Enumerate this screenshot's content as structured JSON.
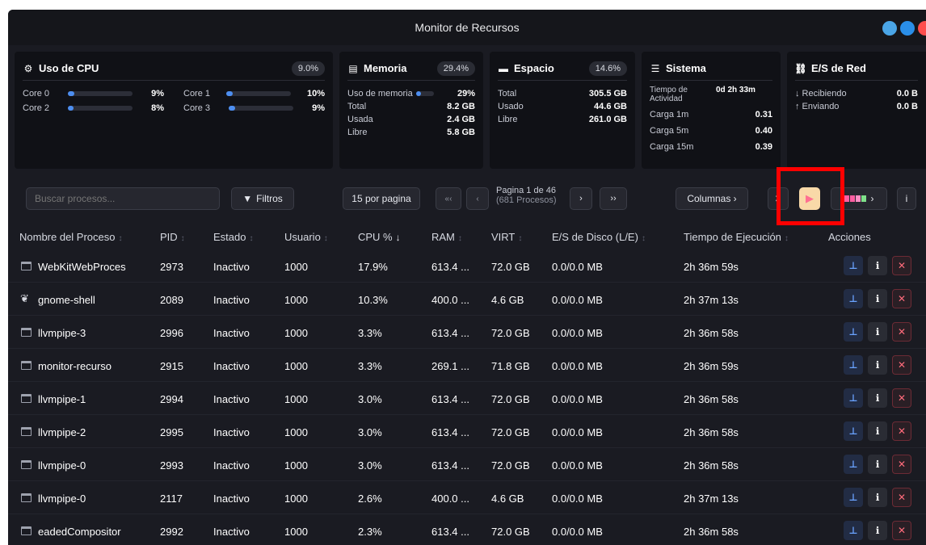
{
  "window": {
    "title": "Monitor de Recursos",
    "controls": [
      "#4aa5e6",
      "#2a8ee8",
      "#ff4d4d"
    ]
  },
  "cpu": {
    "title": "Uso de CPU",
    "badge": "9.0%",
    "cores": [
      {
        "name": "Core 0",
        "value": "9%",
        "pct": 0.09
      },
      {
        "name": "Core 1",
        "value": "10%",
        "pct": 0.1
      },
      {
        "name": "Core 2",
        "value": "8%",
        "pct": 0.08
      },
      {
        "name": "Core 3",
        "value": "9%",
        "pct": 0.09
      }
    ]
  },
  "memory": {
    "title": "Memoria",
    "badge": "29.4%",
    "usage_label": "Uso de memoria",
    "usage_value": "29%",
    "usage_pct": 0.29,
    "rows": [
      {
        "label": "Total",
        "value": "8.2 GB"
      },
      {
        "label": "Usada",
        "value": "2.4 GB"
      },
      {
        "label": "Libre",
        "value": "5.8 GB"
      }
    ]
  },
  "disk": {
    "title": "Espacio",
    "badge": "14.6%",
    "rows": [
      {
        "label": "Total",
        "value": "305.5 GB"
      },
      {
        "label": "Usado",
        "value": "44.6 GB"
      },
      {
        "label": "Libre",
        "value": "261.0 GB"
      }
    ]
  },
  "system": {
    "title": "Sistema",
    "uptime_label": "Tiempo de Actividad",
    "uptime_value": "0d 2h 33m",
    "rows": [
      {
        "label": "Carga 1m",
        "value": "0.31"
      },
      {
        "label": "Carga 5m",
        "value": "0.40"
      },
      {
        "label": "Carga 15m",
        "value": "0.39"
      }
    ]
  },
  "network": {
    "title": "E/S de Red",
    "rows": [
      {
        "label": "↓ Recibiendo",
        "value": "0.0 B"
      },
      {
        "label": "↑ Enviando",
        "value": "0.0 B"
      }
    ]
  },
  "toolbar": {
    "search_placeholder": "Buscar procesos...",
    "filters": "Filtros",
    "per_page": "15 por pagina",
    "first": "«‹",
    "prev": "‹",
    "page": "Pagina 1 de 46",
    "processes": "(681 Procesos)",
    "next": "›",
    "last": "››",
    "columns": "Columnas ›",
    "refresh": "3",
    "colors_more": "›",
    "info": "i"
  },
  "table": {
    "headers": [
      "Nombre del Proceso",
      "PID",
      "Estado",
      "Usuario",
      "CPU %",
      "RAM",
      "VIRT",
      "E/S de Disco (L/E)",
      "Tiempo de Ejecución",
      "Acciones"
    ],
    "rows": [
      {
        "name": "WebKitWebProces",
        "pid": "2973",
        "state": "Inactivo",
        "user": "1000",
        "cpu": "17.9%",
        "ram": "613.4 ...",
        "virt": "72.0 GB",
        "io": "0.0/0.0 MB",
        "time": "2h 36m 59s"
      },
      {
        "name": "gnome-shell",
        "pid": "2089",
        "state": "Inactivo",
        "user": "1000",
        "cpu": "10.3%",
        "ram": "400.0 ...",
        "virt": "4.6 GB",
        "io": "0.0/0.0 MB",
        "time": "2h 37m 13s"
      },
      {
        "name": "llvmpipe-3",
        "pid": "2996",
        "state": "Inactivo",
        "user": "1000",
        "cpu": "3.3%",
        "ram": "613.4 ...",
        "virt": "72.0 GB",
        "io": "0.0/0.0 MB",
        "time": "2h 36m 58s"
      },
      {
        "name": "monitor-recurso",
        "pid": "2915",
        "state": "Inactivo",
        "user": "1000",
        "cpu": "3.3%",
        "ram": "269.1 ...",
        "virt": "71.8 GB",
        "io": "0.0/0.0 MB",
        "time": "2h 36m 59s"
      },
      {
        "name": "llvmpipe-1",
        "pid": "2994",
        "state": "Inactivo",
        "user": "1000",
        "cpu": "3.0%",
        "ram": "613.4 ...",
        "virt": "72.0 GB",
        "io": "0.0/0.0 MB",
        "time": "2h 36m 58s"
      },
      {
        "name": "llvmpipe-2",
        "pid": "2995",
        "state": "Inactivo",
        "user": "1000",
        "cpu": "3.0%",
        "ram": "613.4 ...",
        "virt": "72.0 GB",
        "io": "0.0/0.0 MB",
        "time": "2h 36m 58s"
      },
      {
        "name": "llvmpipe-0",
        "pid": "2993",
        "state": "Inactivo",
        "user": "1000",
        "cpu": "3.0%",
        "ram": "613.4 ...",
        "virt": "72.0 GB",
        "io": "0.0/0.0 MB",
        "time": "2h 36m 58s"
      },
      {
        "name": "llvmpipe-0",
        "pid": "2117",
        "state": "Inactivo",
        "user": "1000",
        "cpu": "2.6%",
        "ram": "400.0 ...",
        "virt": "4.6 GB",
        "io": "0.0/0.0 MB",
        "time": "2h 37m 13s"
      },
      {
        "name": "eadedCompositor",
        "pid": "2992",
        "state": "Inactivo",
        "user": "1000",
        "cpu": "2.3%",
        "ram": "613.4 ...",
        "virt": "72.0 GB",
        "io": "0.0/0.0 MB",
        "time": "2h 36m 58s"
      }
    ]
  },
  "colors": {
    "accent": "#4d8ef0",
    "play_bg": "#f9d9a8",
    "play_icon": "#ff6f91",
    "highlight": "#ff0000"
  }
}
